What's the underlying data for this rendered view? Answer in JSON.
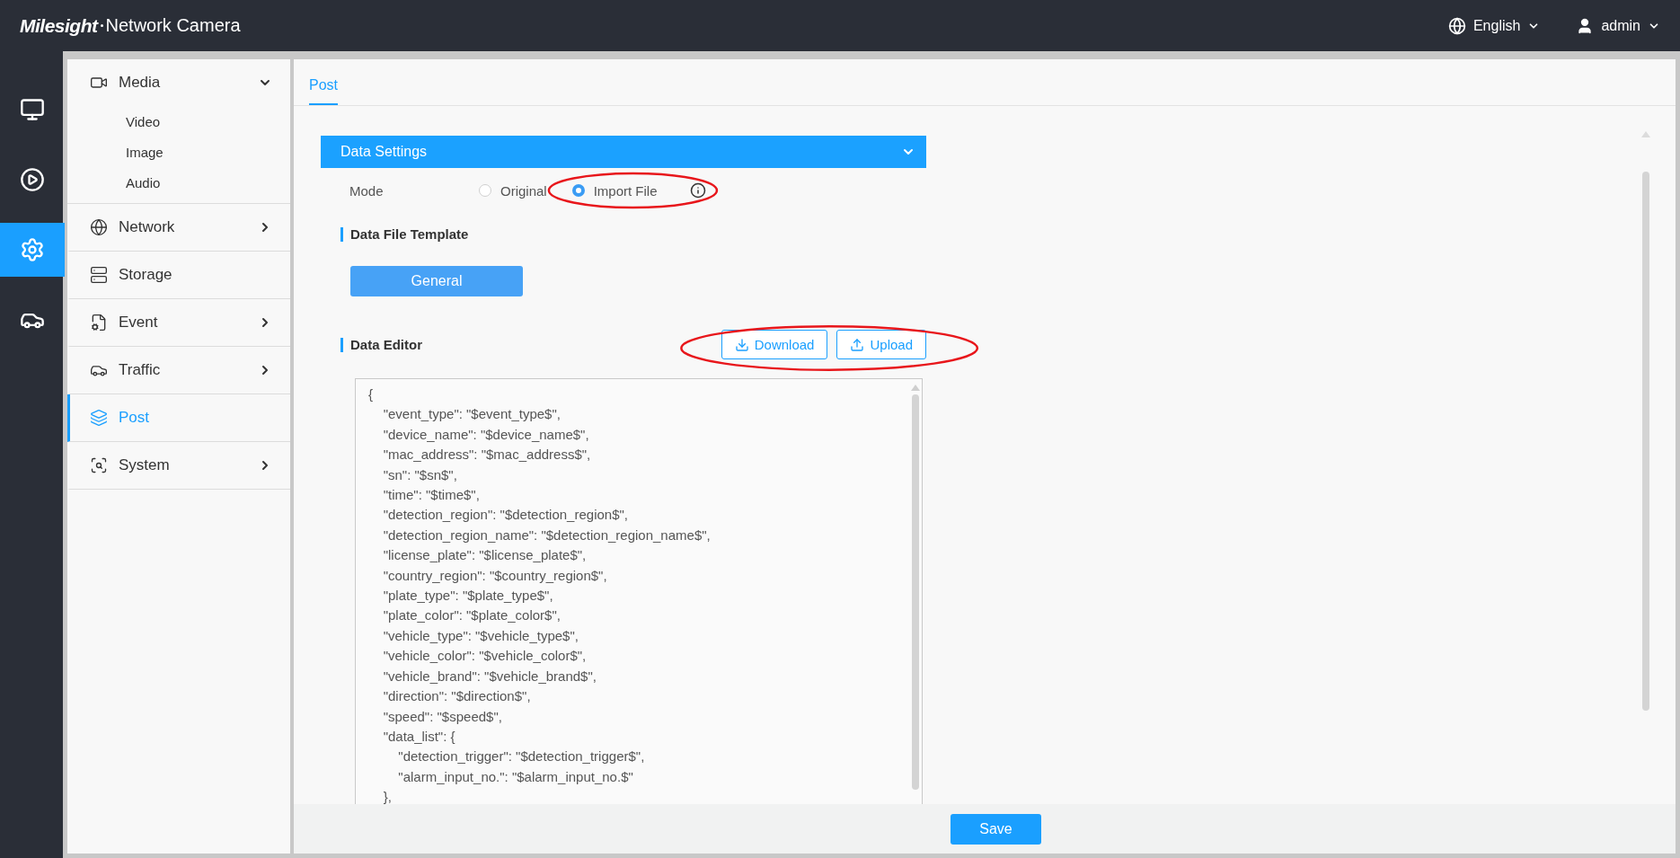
{
  "header": {
    "logo": "Milesight",
    "title": "Network Camera",
    "language": "English",
    "user": "admin"
  },
  "rail": [
    {
      "kind": "live",
      "selected": false
    },
    {
      "kind": "playback",
      "selected": false
    },
    {
      "kind": "settings",
      "selected": true
    },
    {
      "kind": "traffic",
      "selected": false
    }
  ],
  "nav": [
    {
      "kind": "media",
      "label": "Media",
      "group": true,
      "expanded": true,
      "selected": false,
      "children": [
        {
          "label": "Video",
          "selected": false
        },
        {
          "label": "Image",
          "selected": false
        },
        {
          "label": "Audio",
          "selected": false
        }
      ]
    },
    {
      "kind": "network",
      "label": "Network",
      "group": true,
      "expanded": false,
      "selected": false
    },
    {
      "kind": "storage",
      "label": "Storage",
      "group": false,
      "expanded": false,
      "selected": false
    },
    {
      "kind": "event",
      "label": "Event",
      "group": true,
      "expanded": false,
      "selected": false
    },
    {
      "kind": "traffic",
      "label": "Traffic",
      "group": true,
      "expanded": false,
      "selected": false
    },
    {
      "kind": "post",
      "label": "Post",
      "group": false,
      "expanded": false,
      "selected": true
    },
    {
      "kind": "system",
      "label": "System",
      "group": true,
      "expanded": false,
      "selected": false
    }
  ],
  "tabs": [
    {
      "label": "Post",
      "selected": true
    }
  ],
  "section": {
    "title": "Data Settings",
    "expanded": true
  },
  "mode": {
    "label": "Mode",
    "options": [
      {
        "label": "Original",
        "selected": false,
        "highlighted": false,
        "info": false
      },
      {
        "label": "Import File",
        "selected": true,
        "highlighted": true,
        "info": true
      }
    ]
  },
  "template": {
    "title": "Data File Template",
    "buttons": [
      "General"
    ]
  },
  "editor": {
    "title": "Data Editor",
    "highlighted": true,
    "buttons": [
      {
        "kind": "download",
        "label": "Download"
      },
      {
        "kind": "upload",
        "label": "Upload"
      }
    ],
    "value": "{\n    \"event_type\": \"$event_type$\",\n    \"device_name\": \"$device_name$\",\n    \"mac_address\": \"$mac_address$\",\n    \"sn\": \"$sn$\",\n    \"time\": \"$time$\",\n    \"detection_region\": \"$detection_region$\",\n    \"detection_region_name\": \"$detection_region_name$\",\n    \"license_plate\": \"$license_plate$\",\n    \"country_region\": \"$country_region$\",\n    \"plate_type\": \"$plate_type$\",\n    \"plate_color\": \"$plate_color$\",\n    \"vehicle_type\": \"$vehicle_type$\",\n    \"vehicle_color\": \"$vehicle_color$\",\n    \"vehicle_brand\": \"$vehicle_brand$\",\n    \"direction\": \"$direction$\",\n    \"speed\": \"$speed$\",\n    \"data_list\": {\n        \"detection_trigger\": \"$detection_trigger$\",\n        \"alarm_input_no.\": \"$alarm_input_no.$\"\n    },"
  },
  "footer": {
    "save": "Save"
  }
}
